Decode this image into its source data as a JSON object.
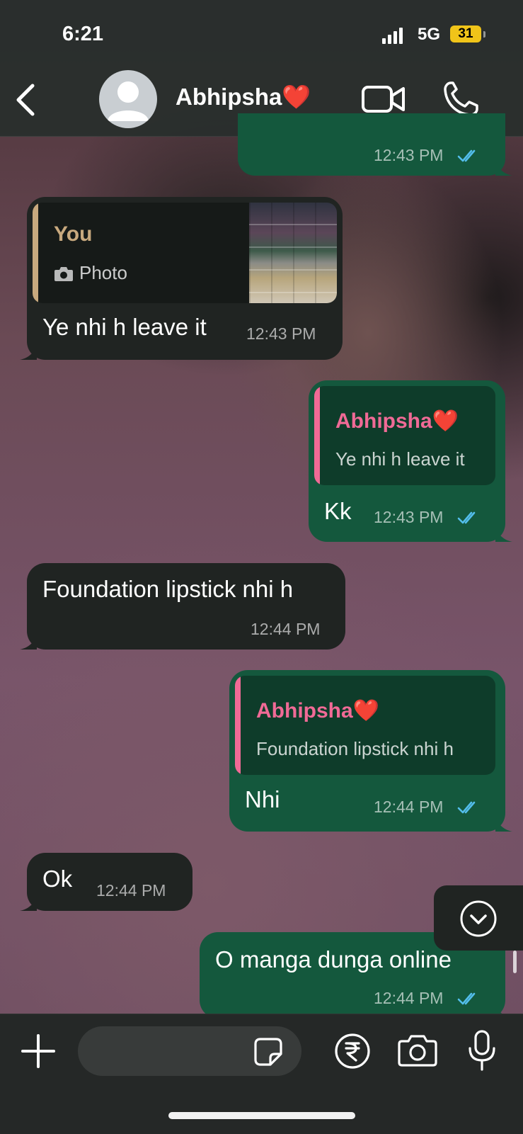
{
  "status_bar": {
    "time": "6:21",
    "network": "5G",
    "battery": "31"
  },
  "header": {
    "contact_name": "Abhipsha❤️"
  },
  "messages": [
    {
      "direction": "outgoing",
      "time": "12:43 PM",
      "read": true
    },
    {
      "direction": "incoming",
      "quote_author": "You",
      "quote_text": "Photo",
      "text": "Ye nhi h leave it",
      "time": "12:43 PM"
    },
    {
      "direction": "outgoing",
      "quote_author": "Abhipsha❤️",
      "quote_text": "Ye nhi h leave it",
      "text": "Kk",
      "time": "12:43 PM",
      "read": true
    },
    {
      "direction": "incoming",
      "text": "Foundation lipstick nhi h",
      "time": "12:44 PM"
    },
    {
      "direction": "outgoing",
      "quote_author": "Abhipsha❤️",
      "quote_text": "Foundation lipstick nhi h",
      "text": "Nhi",
      "time": "12:44 PM",
      "read": true
    },
    {
      "direction": "incoming",
      "text": "Ok",
      "time": "12:44 PM"
    },
    {
      "direction": "outgoing",
      "text": "O manga dunga online",
      "time": "12:44 PM",
      "read": true
    }
  ],
  "colors": {
    "incoming_bubble": "#202422",
    "outgoing_bubble": "#14583d",
    "read_ticks": "#53bdeb",
    "quote_you": "#c8a97e",
    "quote_contact": "#f06a96"
  },
  "composer": {
    "placeholder": ""
  },
  "icons": [
    "back-chevron-icon",
    "avatar-icon",
    "video-call-icon",
    "phone-icon",
    "camera-small-icon",
    "double-check-icon",
    "chevron-down-icon",
    "plus-icon",
    "sticker-icon",
    "rupee-icon",
    "camera-icon",
    "mic-icon"
  ]
}
